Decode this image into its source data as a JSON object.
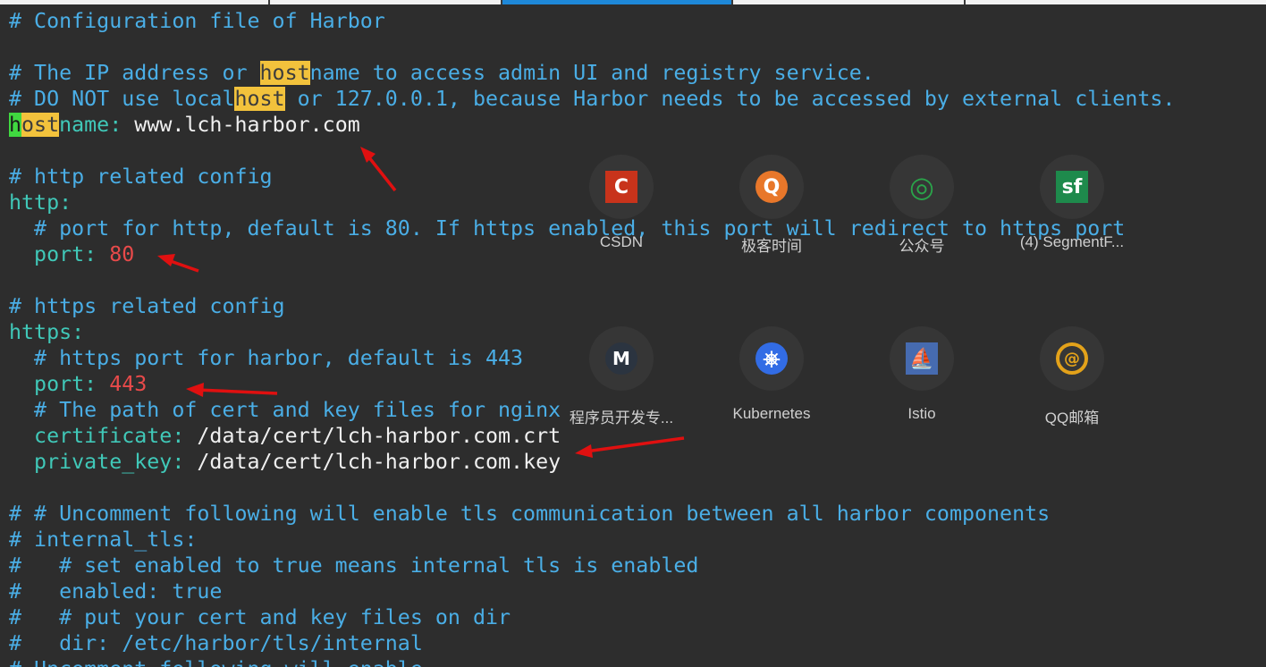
{
  "tabs": [
    {
      "label": ""
    },
    {
      "label": ""
    },
    {
      "label": ""
    },
    {
      "label": ""
    },
    {
      "label": ""
    }
  ],
  "lines": [
    {
      "segs": [
        {
          "t": "# Configuration file of Harbor",
          "c": "c"
        }
      ]
    },
    {
      "segs": []
    },
    {
      "segs": [
        {
          "t": "# The IP address or ",
          "c": "c"
        },
        {
          "t": "host",
          "c": "hl"
        },
        {
          "t": "name to access admin UI and registry service.",
          "c": "c"
        }
      ]
    },
    {
      "segs": [
        {
          "t": "# DO NOT use local",
          "c": "c"
        },
        {
          "t": "host",
          "c": "hl"
        },
        {
          "t": " or 127.0.0.1, because Harbor needs to be accessed by external clients.",
          "c": "c"
        }
      ]
    },
    {
      "segs": [
        {
          "t": "h",
          "c": "cur"
        },
        {
          "t": "ost",
          "c": "hl"
        },
        {
          "t": "name",
          "c": "k"
        },
        {
          "t": ": ",
          "c": "k"
        },
        {
          "t": "www.lch-harbor.com",
          "c": "v"
        }
      ]
    },
    {
      "segs": []
    },
    {
      "segs": [
        {
          "t": "# http related config",
          "c": "c"
        }
      ]
    },
    {
      "segs": [
        {
          "t": "http",
          "c": "k"
        },
        {
          "t": ":",
          "c": "k"
        }
      ]
    },
    {
      "segs": [
        {
          "t": "  # port for http, default is 80. If https enabled, this port will redirect to https port",
          "c": "c"
        }
      ]
    },
    {
      "segs": [
        {
          "t": "  port",
          "c": "k"
        },
        {
          "t": ": ",
          "c": "k"
        },
        {
          "t": "80",
          "c": "n"
        }
      ]
    },
    {
      "segs": []
    },
    {
      "segs": [
        {
          "t": "# https related config",
          "c": "c"
        }
      ]
    },
    {
      "segs": [
        {
          "t": "https",
          "c": "k"
        },
        {
          "t": ":",
          "c": "k"
        }
      ]
    },
    {
      "segs": [
        {
          "t": "  # https port for harbor, default is 443",
          "c": "c"
        }
      ]
    },
    {
      "segs": [
        {
          "t": "  port",
          "c": "k"
        },
        {
          "t": ": ",
          "c": "k"
        },
        {
          "t": "443",
          "c": "n"
        }
      ]
    },
    {
      "segs": [
        {
          "t": "  # The path of cert and key files for nginx",
          "c": "c"
        }
      ]
    },
    {
      "segs": [
        {
          "t": "  certificate",
          "c": "k"
        },
        {
          "t": ": ",
          "c": "k"
        },
        {
          "t": "/data/cert/lch-harbor.com.crt",
          "c": "v"
        }
      ]
    },
    {
      "segs": [
        {
          "t": "  private_key",
          "c": "k"
        },
        {
          "t": ": ",
          "c": "k"
        },
        {
          "t": "/data/cert/lch-harbor.com.key",
          "c": "v"
        }
      ]
    },
    {
      "segs": []
    },
    {
      "segs": [
        {
          "t": "# # Uncomment following will enable tls communication between all harbor components",
          "c": "c"
        }
      ]
    },
    {
      "segs": [
        {
          "t": "# internal_tls:",
          "c": "c"
        }
      ]
    },
    {
      "segs": [
        {
          "t": "#   # set enabled to true means internal tls is enabled",
          "c": "c"
        }
      ]
    },
    {
      "segs": [
        {
          "t": "#   enabled: true",
          "c": "c"
        }
      ]
    },
    {
      "segs": [
        {
          "t": "#   # put your cert and key files on dir",
          "c": "c"
        }
      ]
    },
    {
      "segs": [
        {
          "t": "#   dir: /etc/harbor/tls/internal",
          "c": "c"
        }
      ]
    },
    {
      "segs": [
        {
          "t": "# Uncomment following will enable...",
          "c": "c"
        }
      ]
    }
  ],
  "shortcuts": [
    {
      "label": "CSDN",
      "icon": "csdn-icon",
      "glyph": "C",
      "color": "#c8331b"
    },
    {
      "label": "极客时间",
      "icon": "geektime-icon",
      "glyph": "Q",
      "color": "#e8772a"
    },
    {
      "label": "公众号",
      "icon": "wechat-mp-icon",
      "glyph": "◎",
      "color": "#2aa34a"
    },
    {
      "label": "(4) SegmentF...",
      "icon": "segmentfault-icon",
      "glyph": "sf",
      "color": "#1e8a4c"
    },
    {
      "label": "程序员开发专...",
      "icon": "m-icon",
      "glyph": "M",
      "color": "#2b3440"
    },
    {
      "label": "Kubernetes",
      "icon": "kubernetes-icon",
      "glyph": "⎈",
      "color": "#326ce5"
    },
    {
      "label": "Istio",
      "icon": "istio-icon",
      "glyph": "⛵",
      "color": "#466bb0"
    },
    {
      "label": "QQ邮箱",
      "icon": "qqmail-icon",
      "glyph": "@",
      "color": "#e3a21a"
    }
  ]
}
